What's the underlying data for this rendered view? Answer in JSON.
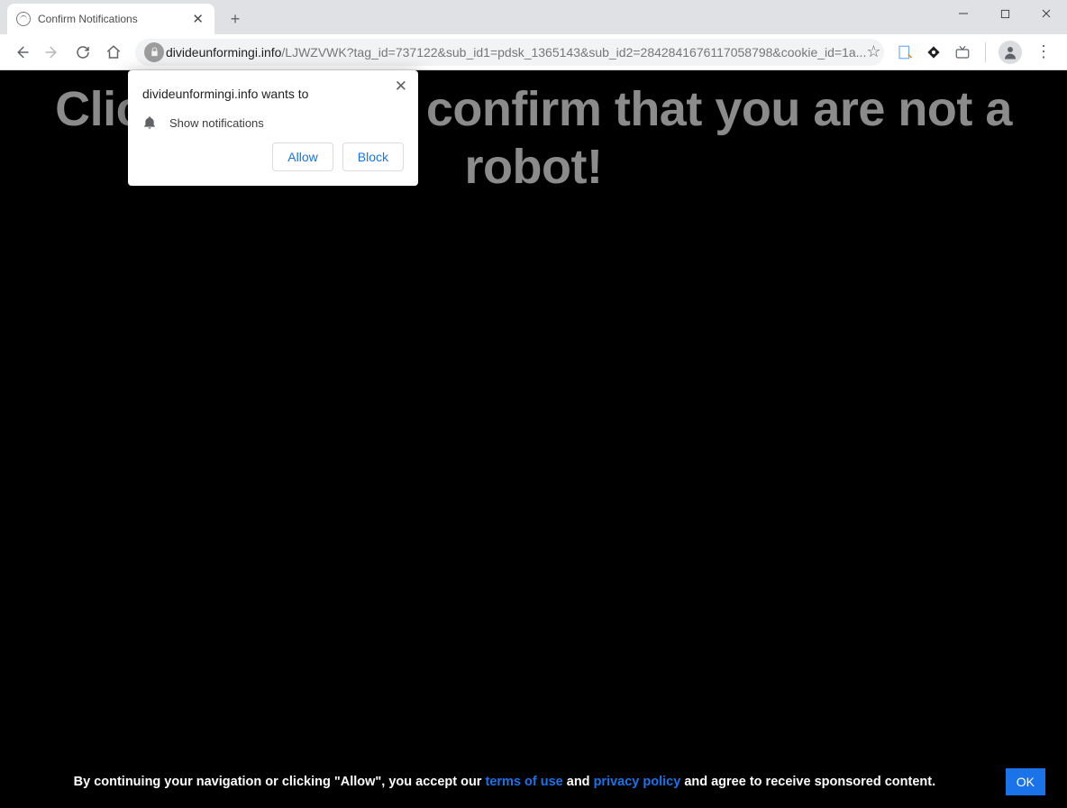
{
  "window": {
    "minimize": "—",
    "maximize": "□",
    "close": "✕"
  },
  "tab": {
    "title": "Confirm Notifications",
    "close": "✕"
  },
  "toolbar": {
    "url_domain": "divideunformingi.info",
    "url_path": "/LJWZVWK?tag_id=737122&sub_id1=pdsk_1365143&sub_id2=2842841676117058798&cookie_id=1a...",
    "new_tab": "+",
    "kebab": "⋮"
  },
  "page": {
    "headline": "Click \"Allow\" to confirm that you are not a robot!",
    "footer_pre": "By continuing your navigation or clicking \"Allow\", you accept our ",
    "footer_link1": "terms of use",
    "footer_mid": " and ",
    "footer_link2": "privacy policy",
    "footer_post": " and agree to receive sponsored content.",
    "ok_label": "OK"
  },
  "perm": {
    "title": "divideunformingi.info wants to",
    "row_label": "Show notifications",
    "allow": "Allow",
    "block": "Block",
    "close": "✕"
  }
}
